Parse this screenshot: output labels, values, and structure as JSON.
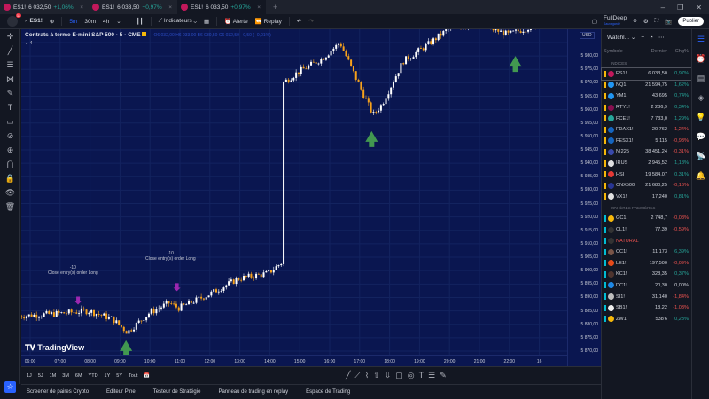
{
  "tabs": [
    {
      "symbol": "ES1!",
      "price": "6 032,50",
      "change": "+1,06%",
      "dir": "up"
    },
    {
      "symbol": "ES1!",
      "price": "6 033,50",
      "change": "+0,97%",
      "dir": "up"
    },
    {
      "symbol": "ES1!",
      "price": "6 033,50",
      "change": "+0,97%",
      "dir": "up",
      "active": true
    }
  ],
  "toolbar": {
    "notif_count": "11",
    "symbol": "ES1!",
    "intervals": [
      "5m",
      "30m",
      "4h"
    ],
    "indicators": "Indicateurs",
    "alert": "Alerte",
    "replay": "Replay",
    "account": "FullDeep",
    "account_sub": "Sauvegardé",
    "publish": "Publier"
  },
  "chart": {
    "title": "Contrats à terme E-mini S&P 500 · 5 · CME",
    "ohlc": "O6 032,00 H6 033,00 B6 030,50 C6 032,50 −0,50 (−0,01%)",
    "indicator_count": "4",
    "currency": "USD",
    "watermark": "TradingView",
    "annotations": [
      {
        "qty": "-10",
        "text": "Close entry(s) order Long"
      },
      {
        "qty": "-10",
        "text": "Close entry(s) order Long"
      }
    ]
  },
  "chart_data": {
    "type": "candlestick",
    "ylim": [
      5868,
      5986
    ],
    "y_ticks": [
      "5 980,00",
      "5 975,00",
      "5 970,00",
      "5 965,00",
      "5 960,00",
      "5 955,00",
      "5 950,00",
      "5 945,00",
      "5 940,00",
      "5 935,00",
      "5 930,00",
      "5 925,00",
      "5 920,00",
      "5 915,00",
      "5 910,00",
      "5 905,00",
      "5 900,00",
      "5 895,00",
      "5 890,00",
      "5 885,00",
      "5 880,00",
      "5 875,00",
      "5 870,00"
    ],
    "x_ticks": [
      "06:00",
      "07:00",
      "08:00",
      "09:00",
      "10:00",
      "11:00",
      "12:00",
      "13:00",
      "14:00",
      "15:00",
      "16:00",
      "17:00",
      "18:00",
      "19:00",
      "20:00",
      "21:00",
      "22:00",
      "16"
    ],
    "path_hours": [
      5.6,
      7.0,
      8.0,
      8.8,
      9.3,
      10.0,
      10.7,
      11.0,
      12.0,
      13.0,
      14.0,
      14.45,
      14.5,
      15.0,
      15.8,
      16.4,
      17.0,
      17.5,
      17.8,
      18.5,
      19.3,
      20.0,
      21.0,
      22.0,
      22.8
    ],
    "path_prices": [
      5883,
      5884,
      5885,
      5882,
      5877,
      5884,
      5888,
      5886,
      5891,
      5897,
      5899,
      5903,
      5970,
      5974,
      5979,
      5985,
      5970,
      5958,
      5962,
      5978,
      5984,
      5990,
      5992,
      5988,
      5991
    ]
  },
  "watchlist": {
    "title": "Watchl...",
    "columns": [
      "Symbole",
      "Dernier",
      "Chg%"
    ],
    "sections": [
      {
        "name": "INDICES",
        "rows": [
          {
            "sym": "ES1!",
            "last": "6 033,50",
            "chg": "0,97%",
            "dir": "up",
            "color": "#c2185b"
          },
          {
            "sym": "NQ1!",
            "last": "21 594,75",
            "chg": "1,62%",
            "dir": "up",
            "color": "#2196f3"
          },
          {
            "sym": "YM1!",
            "last": "43 695",
            "chg": "0,74%",
            "dir": "up",
            "color": "#2196f3"
          },
          {
            "sym": "RTY1!",
            "last": "2 286,9",
            "chg": "0,34%",
            "dir": "up",
            "color": "#880e4f"
          },
          {
            "sym": "FCE1!",
            "last": "7 733,0",
            "chg": "1,29%",
            "dir": "up",
            "color": "#26a69a"
          },
          {
            "sym": "FDAX1!",
            "last": "20 762",
            "chg": "-1,24%",
            "dir": "dn",
            "color": "#1565c0"
          },
          {
            "sym": "FESX1!",
            "last": "5 115",
            "chg": "-0,93%",
            "dir": "dn",
            "color": "#1565c0"
          },
          {
            "sym": "NI225",
            "last": "38 451,24",
            "chg": "-0,31%",
            "dir": "dn",
            "color": "#3949ab"
          },
          {
            "sym": "IRUS",
            "last": "2 945,52",
            "chg": "1,18%",
            "dir": "up",
            "color": "#e0e0e0"
          },
          {
            "sym": "HSI",
            "last": "19 584,07",
            "chg": "0,31%",
            "dir": "up",
            "color": "#e53935"
          },
          {
            "sym": "CNX500",
            "last": "21 680,25",
            "chg": "-0,16%",
            "dir": "dn",
            "color": "#283593"
          },
          {
            "sym": "VX1!",
            "last": "17,240",
            "chg": "0,81%",
            "dir": "up",
            "color": "#e0e0e0"
          }
        ]
      },
      {
        "name": "MATIÈRES PREMIÈRES",
        "rows": [
          {
            "sym": "GC1!",
            "last": "2 748,7",
            "chg": "-0,08%",
            "dir": "dn",
            "color": "#f5b70a"
          },
          {
            "sym": "CL1!",
            "last": "77,39",
            "chg": "-0,59%",
            "dir": "dn",
            "color": "#333"
          },
          {
            "sym": "NATURAL",
            "last": "",
            "chg": "",
            "dir": "dn",
            "color": "#333",
            "header": true
          },
          {
            "sym": "CC1!",
            "last": "11 173",
            "chg": "6,39%",
            "dir": "up",
            "color": "#795548"
          },
          {
            "sym": "LE1!",
            "last": "197,500",
            "chg": "-0,09%",
            "dir": "dn",
            "color": "#e64a19"
          },
          {
            "sym": "KC1!",
            "last": "328,35",
            "chg": "0,37%",
            "dir": "up",
            "color": "#4e342e"
          },
          {
            "sym": "DC1!",
            "last": "20,30",
            "chg": "0,00%",
            "dir": "flat",
            "color": "#1e88e5"
          },
          {
            "sym": "SI1!",
            "last": "31,140",
            "chg": "-1,84%",
            "dir": "dn",
            "color": "#bdbdbd"
          },
          {
            "sym": "SB1!",
            "last": "18,22",
            "chg": "-1,03%",
            "dir": "dn",
            "color": "#eeeeee"
          },
          {
            "sym": "ZW1!",
            "last": "538'6",
            "chg": "0,23%",
            "dir": "up",
            "color": "#f5b70a"
          }
        ]
      }
    ]
  },
  "range_buttons": [
    "1J",
    "5J",
    "1M",
    "3M",
    "6M",
    "YTD",
    "1Y",
    "5Y",
    "Tout"
  ],
  "bottom_tabs": [
    "Screener de paires Crypto",
    "Editeur Pine",
    "Testeur de Stratégie",
    "Panneau de trading en replay",
    "Espace de Trading"
  ]
}
